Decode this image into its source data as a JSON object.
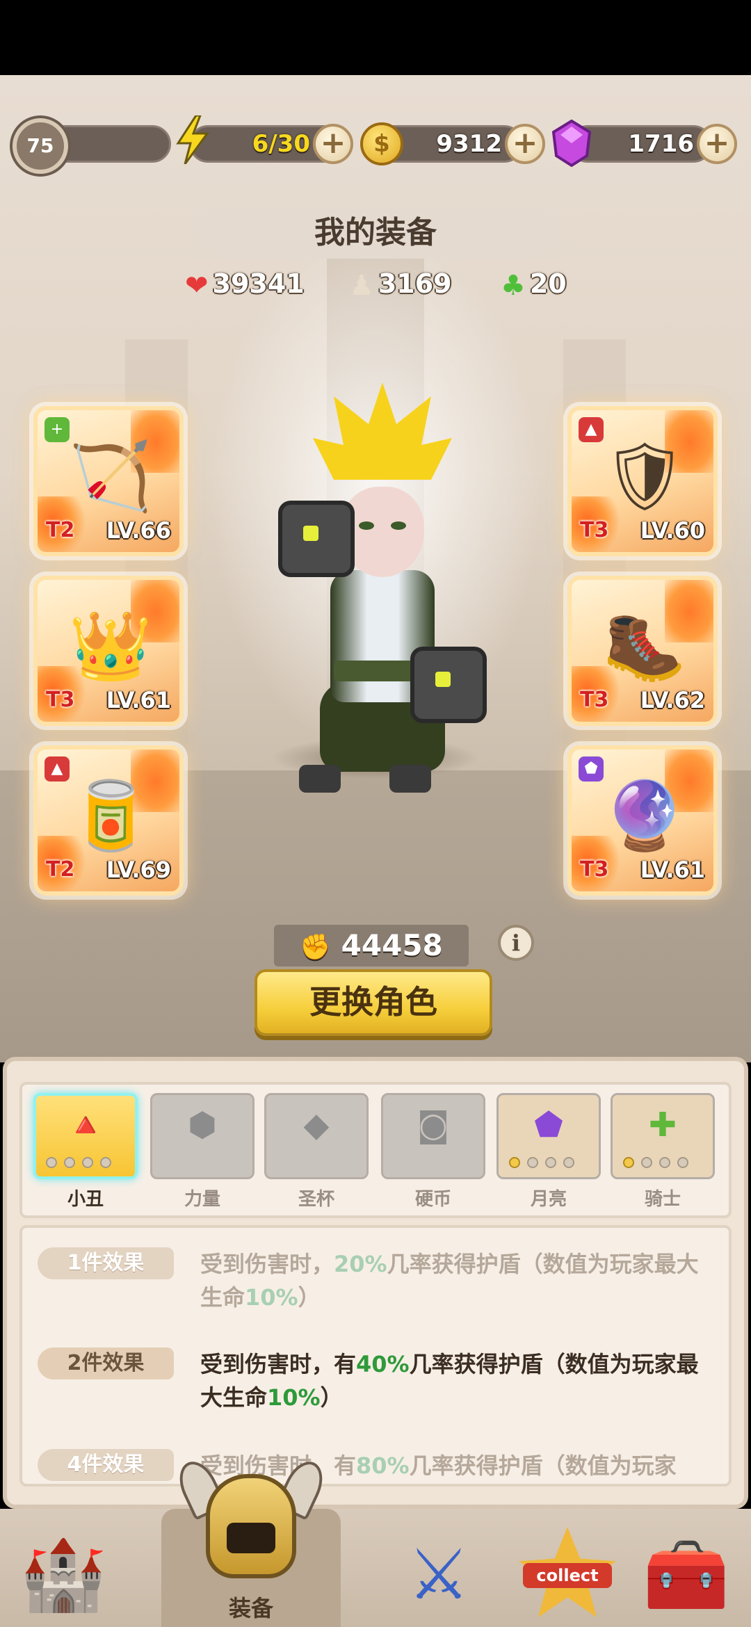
{
  "topbar": {
    "level": "75",
    "energy": {
      "icon": "lightning-icon",
      "value": "6/30"
    },
    "coins": {
      "icon": "coin-icon",
      "value": "9312"
    },
    "gems": {
      "icon": "gem-icon",
      "value": "1716"
    },
    "plus_label": "+"
  },
  "title": "我的装备",
  "stats": {
    "hp": {
      "icon": "heart-icon",
      "value": "39341"
    },
    "attack": {
      "icon": "attack-icon",
      "value": "3169"
    },
    "luck": {
      "icon": "clover-icon",
      "value": "20"
    }
  },
  "equipment": {
    "left": [
      {
        "slot": "weapon",
        "glyph": "🏹",
        "set_icon": "+",
        "set_color": "#5fb83a",
        "tier": "T2",
        "level": "LV.66"
      },
      {
        "slot": "crown",
        "glyph": "👑",
        "set_icon": "",
        "set_color": "",
        "tier": "T3",
        "level": "LV.61"
      },
      {
        "slot": "bracer",
        "glyph": "🥫",
        "set_icon": "▲",
        "set_color": "#d83a3a",
        "tier": "T2",
        "level": "LV.69"
      }
    ],
    "right": [
      {
        "slot": "armor",
        "glyph": "🛡",
        "set_icon": "▲",
        "set_color": "#d83a3a",
        "tier": "T3",
        "level": "LV.60"
      },
      {
        "slot": "boots",
        "glyph": "🥾",
        "set_icon": "",
        "set_color": "",
        "tier": "T3",
        "level": "LV.62"
      },
      {
        "slot": "orb",
        "glyph": "🔮",
        "set_icon": "⬟",
        "set_color": "#8a4ad6",
        "tier": "T3",
        "level": "LV.61"
      }
    ]
  },
  "power": {
    "icon": "fist-icon",
    "value": "44458"
  },
  "info_label": "i",
  "swap_button": "更换角色",
  "sets": [
    {
      "name": "小丑",
      "icon": "clown-emblem-icon",
      "glyph": "🔺",
      "active": true,
      "dots": 4,
      "dots_on": 0,
      "show_dots": true
    },
    {
      "name": "力量",
      "icon": "strength-emblem-icon",
      "glyph": "⬢",
      "active": false,
      "show_dots": false
    },
    {
      "name": "圣杯",
      "icon": "grail-emblem-icon",
      "glyph": "◆",
      "active": false,
      "show_dots": false
    },
    {
      "name": "硬币",
      "icon": "coin-emblem-icon",
      "glyph": "◙",
      "active": false,
      "show_dots": false
    },
    {
      "name": "月亮",
      "icon": "moon-emblem-icon",
      "glyph": "⬟",
      "active": false,
      "dots": 4,
      "dots_on": 1,
      "show_dots": true
    },
    {
      "name": "骑士",
      "icon": "knight-emblem-icon",
      "glyph": "✚",
      "active": false,
      "dots": 4,
      "dots_on": 1,
      "show_dots": true
    }
  ],
  "effects": [
    {
      "tag": "1件效果",
      "pre": "受到伤害时，",
      "hl1": "20%",
      "mid": "几率获得护盾（数值为玩家最大生命",
      "hl2": "10%",
      "post": "）",
      "state": "dim"
    },
    {
      "tag": "2件效果",
      "pre": "受到伤害时，有",
      "hl1": "40%",
      "mid": "几率获得护盾（数值为玩家最大生命",
      "hl2": "10%",
      "post": "）",
      "state": "on"
    },
    {
      "tag": "4件效果",
      "pre": "受到伤害时，有",
      "hl1": "80%",
      "mid": "几率获得护盾（数值为玩家",
      "hl2": "",
      "post": "",
      "state": "dim"
    }
  ],
  "nav": {
    "castle": {
      "icon": "castle-icon",
      "glyph": "🏰"
    },
    "equipment": {
      "icon": "helmet-icon",
      "label": "装备"
    },
    "battle": {
      "icon": "sword-shield-icon",
      "glyph": "⚔"
    },
    "collect": {
      "icon": "collect-star-icon",
      "label": "collect"
    },
    "chest": {
      "icon": "treasure-chest-icon",
      "glyph": "🧰"
    }
  },
  "colors": {
    "accent_yellow": "#f6cf3c",
    "highlight_green": "#2e9a3a",
    "tier_red": "#d32020"
  }
}
